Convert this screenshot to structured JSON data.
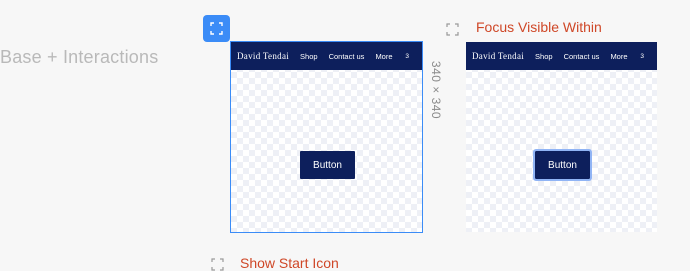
{
  "section": {
    "title": "Base + Interactions"
  },
  "size_label": "340 × 340",
  "variants": [
    {
      "label": "",
      "navbar": {
        "brand": "David Tendai",
        "links": [
          "Shop",
          "Contact us",
          "More"
        ],
        "cart_count": "3"
      },
      "button_label": "Button"
    },
    {
      "label": "Focus Visible Within",
      "navbar": {
        "brand": "David Tendai",
        "links": [
          "Shop",
          "Contact us",
          "More"
        ],
        "cart_count": "3"
      },
      "button_label": "Button"
    }
  ],
  "next_variant": {
    "label": "Show Start Icon"
  },
  "colors": {
    "accent": "#3b8cf7",
    "navy": "#0d1f5c",
    "label_red": "#cf4727",
    "focus_ring": "#90b4f5"
  },
  "icons": {
    "focus_frame": "focus-frame-icon"
  }
}
